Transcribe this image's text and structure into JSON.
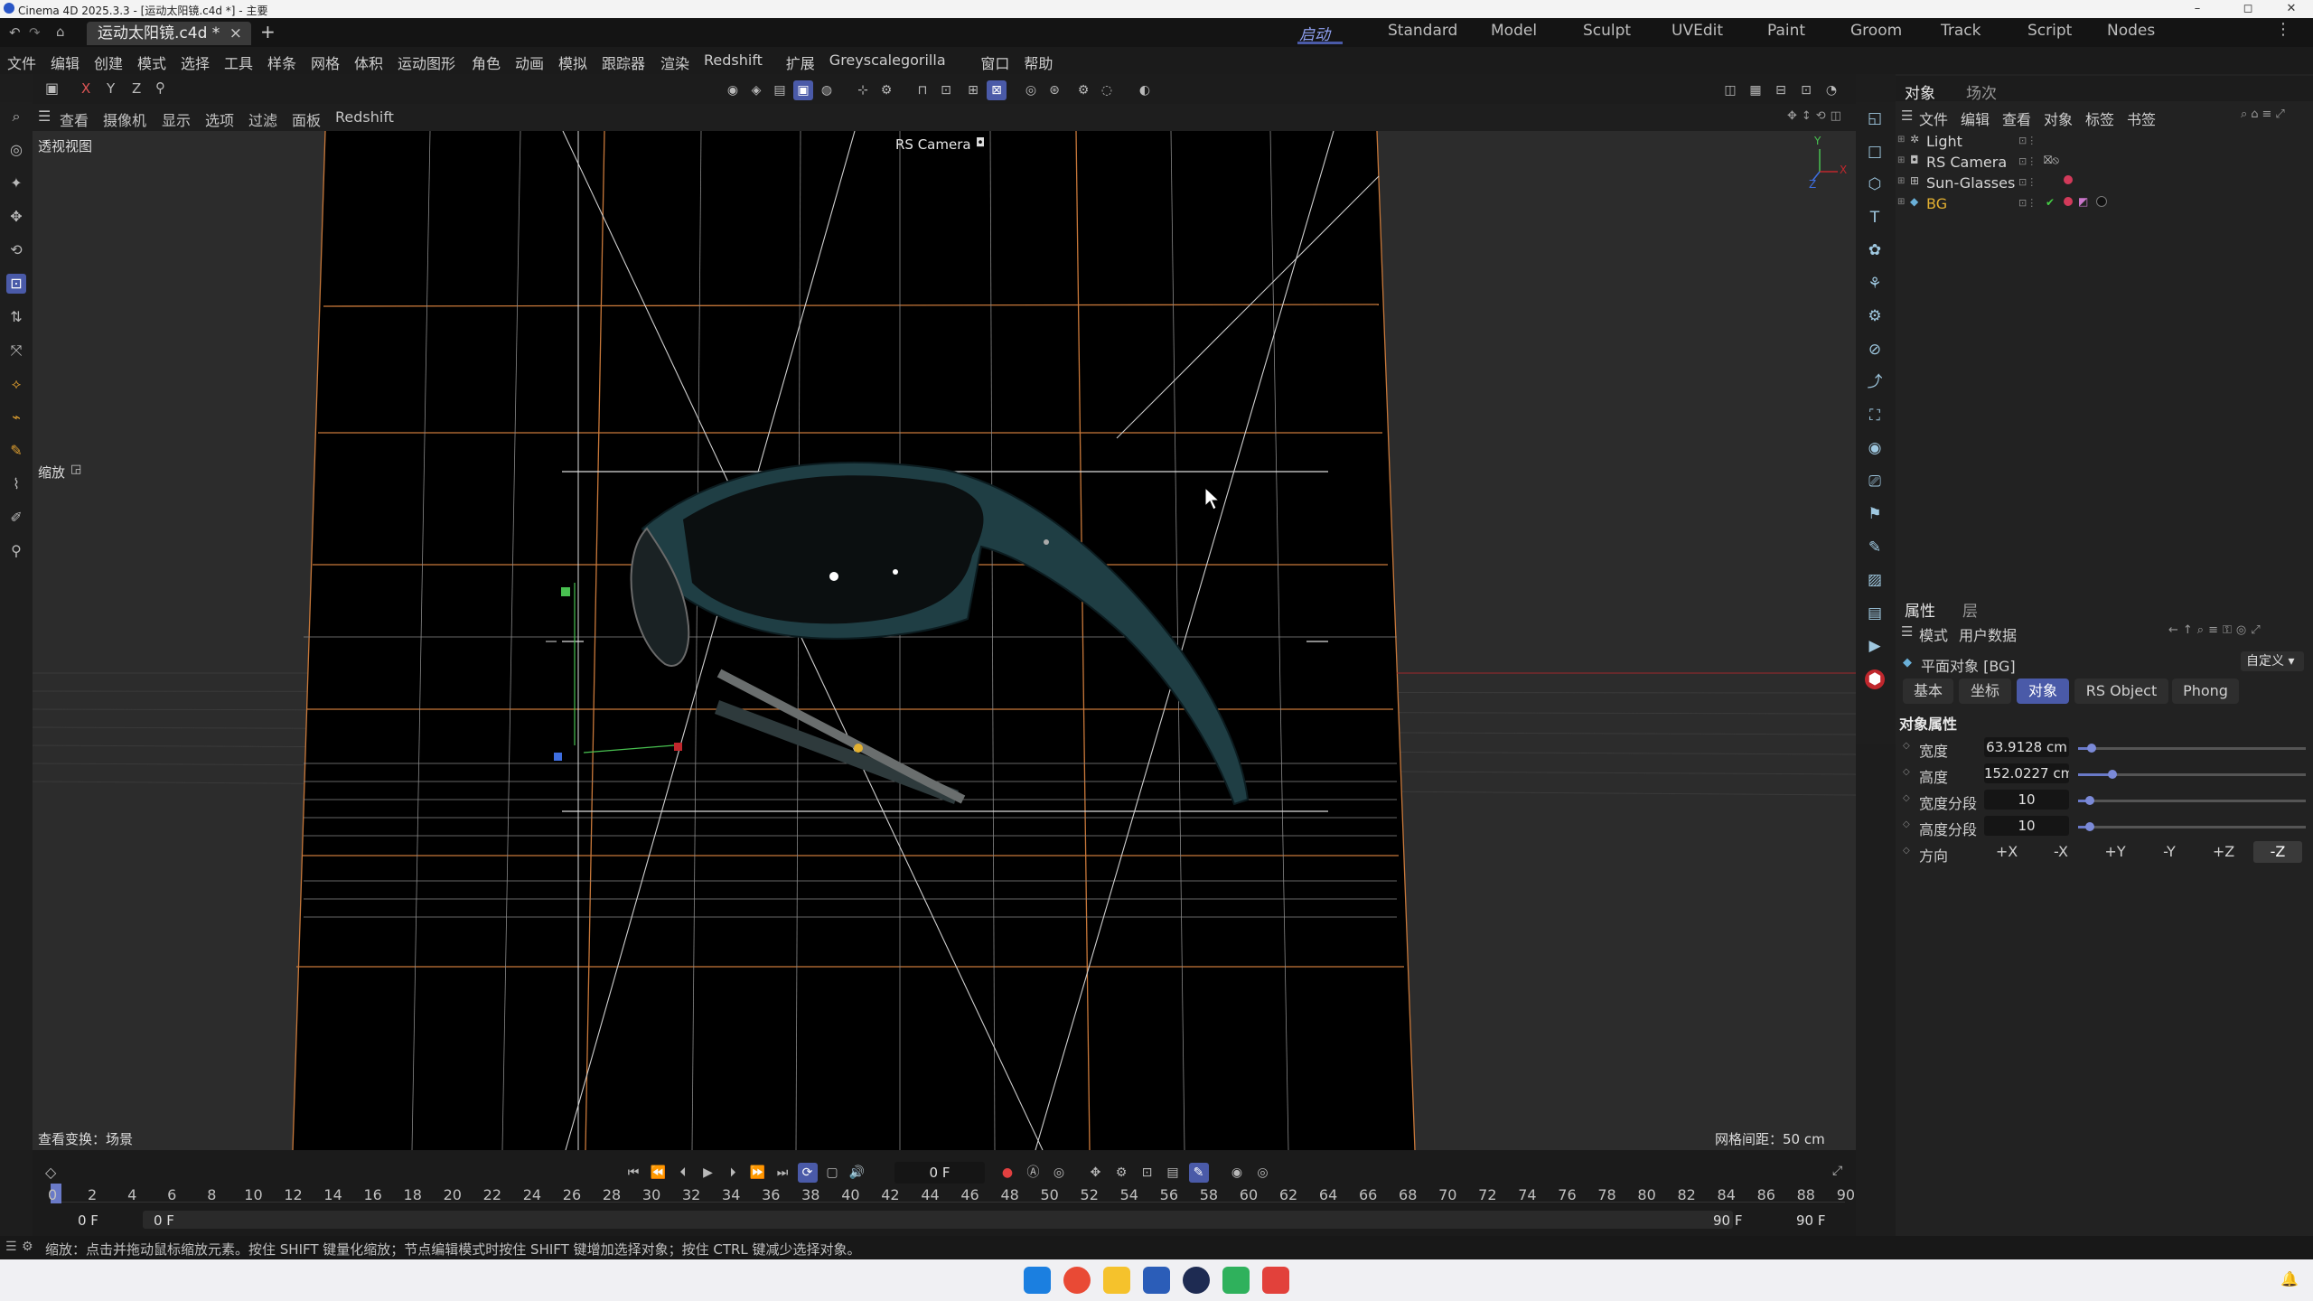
{
  "window": {
    "title": "Cinema 4D 2025.3.3 - [运动太阳镜.c4d *] - 主要",
    "minimize": "–",
    "maximize": "◻",
    "close": "✕"
  },
  "tabs": {
    "doc_tab": "运动太阳镜.c4d *",
    "close": "×",
    "add": "+"
  },
  "layouts": [
    "启动",
    "Standard",
    "Model",
    "Sculpt",
    "UVEdit",
    "Paint",
    "Groom",
    "Track",
    "Script",
    "Nodes"
  ],
  "menu": [
    "文件",
    "编辑",
    "创建",
    "模式",
    "选择",
    "工具",
    "样条",
    "网格",
    "体积",
    "运动图形",
    "角色",
    "动画",
    "模拟",
    "跟踪器",
    "渲染",
    "Redshift",
    "扩展",
    "Greyscalegorilla",
    "窗口",
    "帮助"
  ],
  "viewport_menu": [
    "查看",
    "摄像机",
    "显示",
    "选项",
    "过滤",
    "面板",
    "Redshift"
  ],
  "viewport": {
    "name": "透视视图",
    "camera_label": "RS Camera",
    "zoom_label": "缩放",
    "bottom_left": "查看变换：场景",
    "bottom_right": "网格间距：50 cm",
    "axis": {
      "y": "Y",
      "x": "X",
      "z": "Z"
    }
  },
  "object_panel": {
    "tabs": [
      "对象",
      "场次"
    ],
    "menu": [
      "文件",
      "编辑",
      "查看",
      "对象",
      "标签",
      "书签"
    ],
    "objects": [
      {
        "name": "Light"
      },
      {
        "name": "RS Camera"
      },
      {
        "name": "Sun-Glasses"
      },
      {
        "name": "BG"
      }
    ]
  },
  "attr_panel": {
    "tabs": [
      "属性",
      "层"
    ],
    "menu": [
      "模式",
      "用户数据"
    ],
    "object_title": "平面对象 [BG]",
    "preset": "自定义",
    "subtabs": [
      "基本",
      "坐标",
      "对象",
      "RS Object",
      "Phong"
    ],
    "section": "对象属性",
    "fields": [
      {
        "label": "宽度",
        "value": "63.9128 cm",
        "level": 0.06
      },
      {
        "label": "高度",
        "value": "152.0227 cm",
        "level": 0.15
      },
      {
        "label": "宽度分段",
        "value": "10",
        "level": 0.05
      },
      {
        "label": "高度分段",
        "value": "10",
        "level": 0.05
      }
    ],
    "direction_label": "方向",
    "directions": [
      "+X",
      "-X",
      "+Y",
      "-Y",
      "+Z",
      "-Z"
    ],
    "direction_selected": "-Z"
  },
  "timeline": {
    "current_frame": "0 F",
    "ticks": [
      "0",
      "2",
      "4",
      "6",
      "8",
      "10",
      "12",
      "14",
      "16",
      "18",
      "20",
      "22",
      "24",
      "26",
      "28",
      "30",
      "32",
      "34",
      "36",
      "38",
      "40",
      "42",
      "44",
      "46",
      "48",
      "50",
      "52",
      "54",
      "56",
      "58",
      "60",
      "62",
      "64",
      "66",
      "68",
      "70",
      "72",
      "74",
      "76",
      "78",
      "80",
      "82",
      "84",
      "86",
      "88",
      "90"
    ],
    "start": "0 F",
    "min": "0 F",
    "max": "90 F",
    "end": "90 F"
  },
  "status": "缩放：点击并拖动鼠标缩放元素。按住 SHIFT 键量化缩放；节点编辑模式时按住 SHIFT 键增加选择对象；按住 CTRL 键减少选择对象。",
  "colors": {
    "accent": "#4a5aa8",
    "grid_orange": "#c8783a",
    "bg_selected": "#e3b030",
    "axis_red": "#c0272d",
    "axis_green": "#48c050",
    "axis_blue": "#3e6ee0"
  }
}
